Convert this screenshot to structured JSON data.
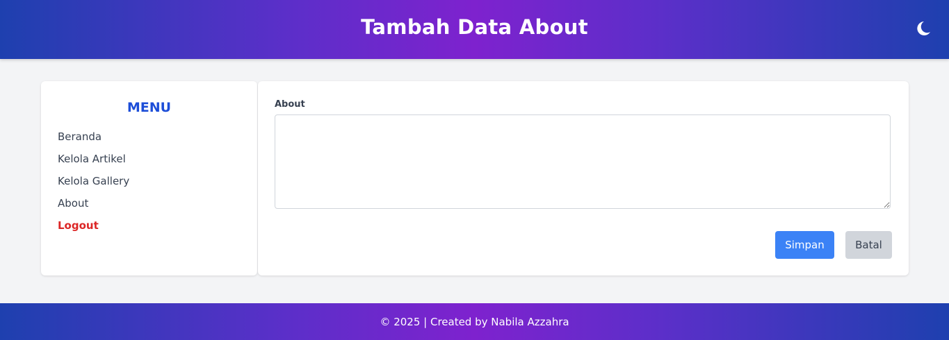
{
  "header": {
    "title": "Tambah Data About",
    "theme_toggle_icon": "moon-icon"
  },
  "sidebar": {
    "title": "MENU",
    "items": [
      {
        "label": "Beranda"
      },
      {
        "label": "Kelola Artikel"
      },
      {
        "label": "Kelola Gallery"
      },
      {
        "label": "About"
      },
      {
        "label": "Logout"
      }
    ]
  },
  "form": {
    "about_label": "About",
    "about_value": "",
    "save_label": "Simpan",
    "cancel_label": "Batal"
  },
  "footer": {
    "text": "© 2025 | Created by Nabila Azzahra"
  },
  "colors": {
    "gradient_edge": "#1e40af",
    "gradient_center": "#7e22ce",
    "menu_title": "#1d4ed8",
    "logout": "#dc2626",
    "save_button": "#3b82f6",
    "cancel_button": "#d1d5db"
  }
}
